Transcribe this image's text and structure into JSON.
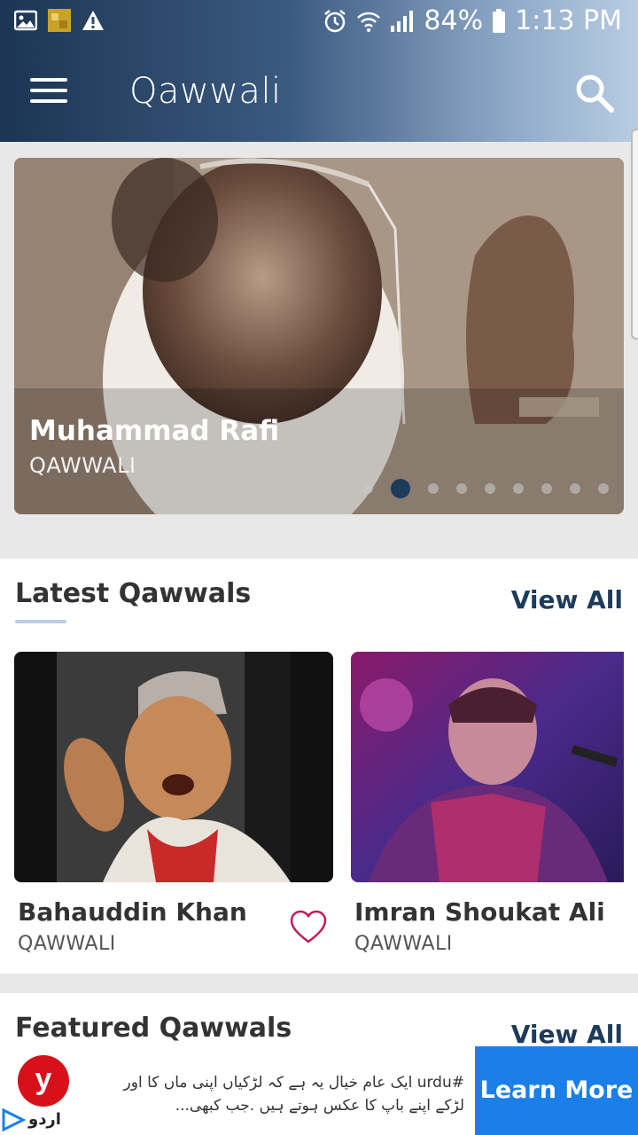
{
  "status_bar": {
    "battery": "84%",
    "time": "1:13 PM",
    "icons": [
      "image-icon",
      "notification-app-icon",
      "warning-icon",
      "alarm-icon",
      "wifi-icon",
      "signal-icon",
      "battery-icon"
    ]
  },
  "app_bar": {
    "title": "Qawwali",
    "menu_icon": "hamburger-menu-icon",
    "search_icon": "search-icon",
    "colors": {
      "gradient_start": "#1c3553",
      "gradient_end": "#b8cde3"
    }
  },
  "hero": {
    "name": "Muhammad Rafi",
    "category": "QAWWALI",
    "slide_count": 9,
    "active_slide": 2
  },
  "latest": {
    "title": "Latest Qawwals",
    "view_all": "View All",
    "items": [
      {
        "name": "Bahauddin Khan",
        "category": "QAWWALI",
        "favorite_icon": "heart-outline-icon"
      },
      {
        "name": "Imran Shoukat Ali",
        "category": "QAWWALI"
      }
    ]
  },
  "featured": {
    "title": "Featured Qawwals",
    "view_all": "View All"
  },
  "ad": {
    "logo_letter": "y",
    "label": "اردو",
    "text": "#urdu ایک عام خیال یہ ہے کہ لڑکیاں اپنی ماں کا اور لڑکے اپنے باپ کا عکس ہوتے ہیں .جب کبھی...",
    "cta": "Learn More",
    "cta_color": "#1a7fe8"
  },
  "accent_color": "#1e3b5c",
  "heart_color": "#c2185b"
}
